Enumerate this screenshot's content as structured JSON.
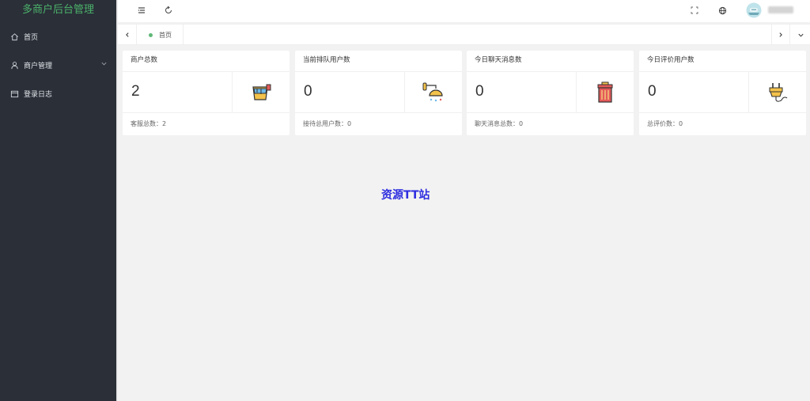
{
  "app": {
    "title": "多商户后台管理"
  },
  "sidebar": {
    "items": [
      {
        "label": "首页",
        "icon": "home-icon"
      },
      {
        "label": "商户管理",
        "icon": "user-icon",
        "expandable": true
      },
      {
        "label": "登录日志",
        "icon": "calendar-icon"
      }
    ]
  },
  "header": {
    "username": " "
  },
  "tabs": [
    {
      "label": "首页",
      "active": true
    }
  ],
  "cards": [
    {
      "title": "商户总数",
      "value": "2",
      "footer": "客服总数：2",
      "icon": "paint-bucket-icon"
    },
    {
      "title": "当前排队用户数",
      "value": "0",
      "footer": "接待总用户数：0",
      "icon": "shower-icon"
    },
    {
      "title": "今日聊天消息数",
      "value": "0",
      "footer": "聊天消息总数：0",
      "icon": "trash-can-icon"
    },
    {
      "title": "今日评价用户数",
      "value": "0",
      "footer": "总评价数：0",
      "icon": "plug-icon"
    }
  ],
  "watermark": "资源TT站",
  "colors": {
    "sidebar_bg": "#2a2f38",
    "logo_text": "#4cb26a",
    "active_dot": "#5fb878",
    "watermark": "#2e2ee0"
  }
}
